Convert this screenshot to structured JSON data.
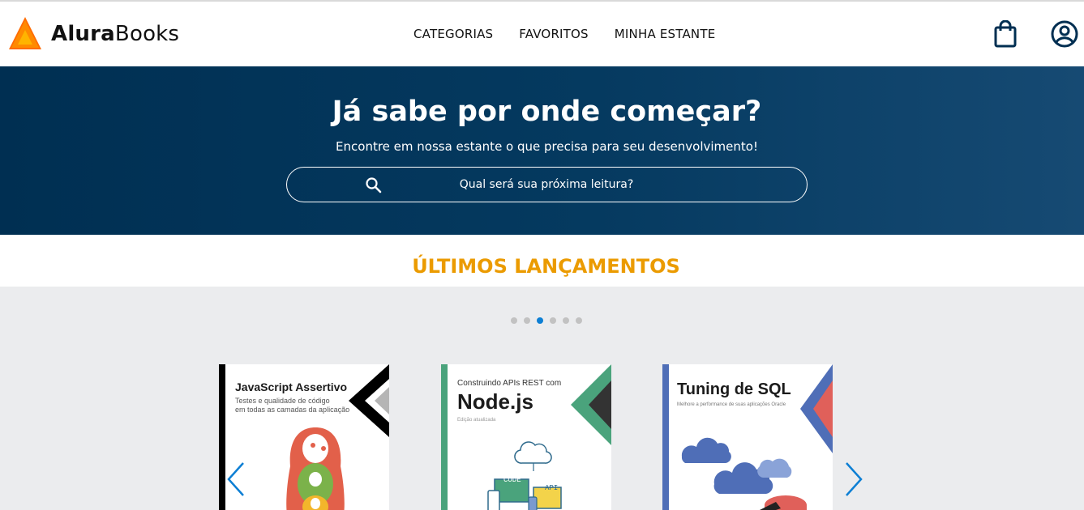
{
  "header": {
    "brand_bold": "Alura",
    "brand_light": "Books",
    "nav": [
      "CATEGORIAS",
      "FAVORITOS",
      "MINHA ESTANTE"
    ]
  },
  "hero": {
    "title": "Já sabe por onde começar?",
    "subtitle": "Encontre em nossa estante o que precisa para seu desenvolvimento!",
    "search_placeholder": "Qual será sua próxima leitura?"
  },
  "section": {
    "title": "ÚLTIMOS LANÇAMENTOS",
    "dots_total": 6,
    "active_dot": 3
  },
  "books": [
    {
      "title": "JavaScript Assertivo",
      "subtitle_line1": "Testes e qualidade de código",
      "subtitle_line2": "em todas as camadas da aplicação",
      "accent": "#000000"
    },
    {
      "pre_title": "Construindo APIs REST com",
      "title": "Node.js",
      "edition": "Edição atualizada",
      "code_label": "CODE",
      "api_label": "API",
      "accent": "#4aa37c"
    },
    {
      "title": "Tuning de SQL",
      "subtitle": "Melhore a performance de suas aplicações Oracle",
      "accent": "#4f6eb7"
    }
  ],
  "colors": {
    "hero_bg": "#002f52",
    "section_title": "#eb9b00",
    "active_dot": "#0d7fd4",
    "arrow": "#0d7fd4",
    "logo_orange": "#ff8a00"
  },
  "icons": [
    "logo-icon",
    "shopping-bag-icon",
    "user-icon",
    "search-icon",
    "chevron-left-icon",
    "chevron-right-icon"
  ]
}
